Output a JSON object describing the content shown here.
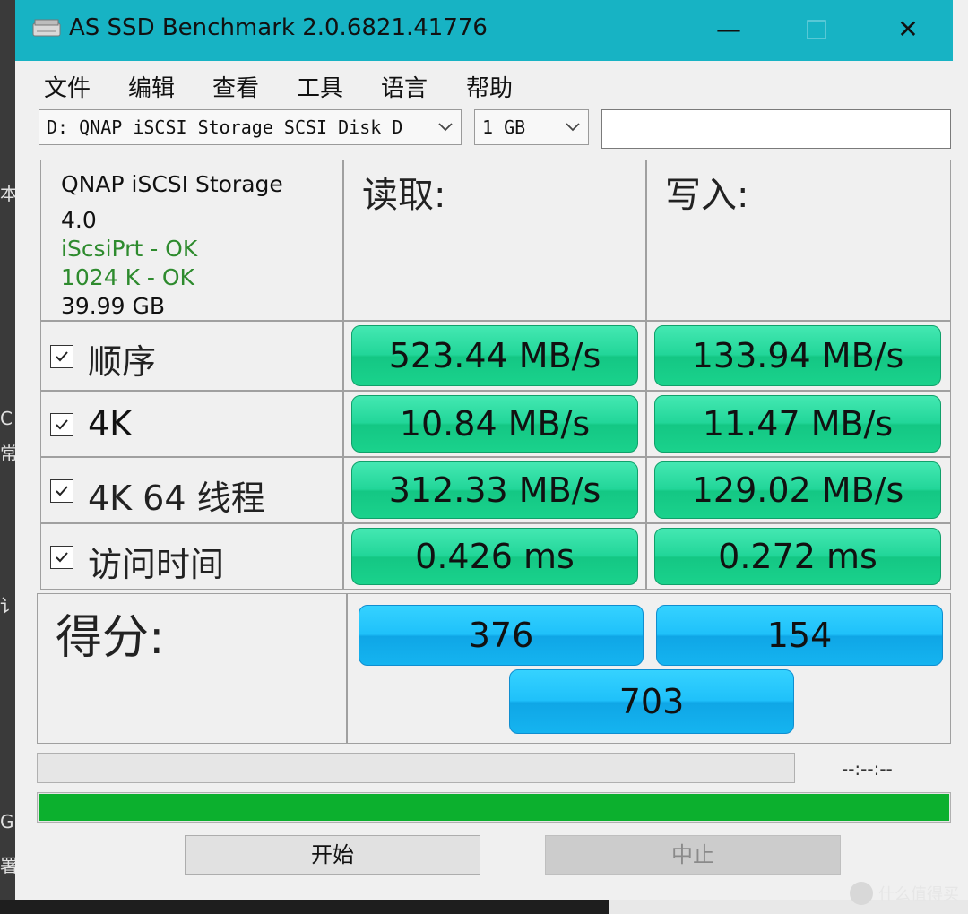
{
  "window": {
    "title": "AS SSD Benchmark 2.0.6821.41776",
    "minimize_glyph": "—",
    "close_glyph": "✕"
  },
  "menu": [
    "文件",
    "编辑",
    "查看",
    "工具",
    "语言",
    "帮助"
  ],
  "toolbar": {
    "drive_select": "D: QNAP iSCSI Storage SCSI Disk D",
    "size_select": "1 GB",
    "text_field_value": ""
  },
  "drive_info": {
    "name": "QNAP iSCSI Storage",
    "version": "4.0",
    "driver_status": "iScsiPrt - OK",
    "alignment_status": "1024 K - OK",
    "capacity": "39.99 GB"
  },
  "headers": {
    "read": "读取:",
    "write": "写入:"
  },
  "rows": [
    {
      "label": "顺序",
      "checked": true,
      "read": "523.44 MB/s",
      "write": "133.94 MB/s"
    },
    {
      "label": "4K",
      "checked": true,
      "read": "10.84 MB/s",
      "write": "11.47 MB/s"
    },
    {
      "label": "4K 64 线程",
      "checked": true,
      "read": "312.33 MB/s",
      "write": "129.02 MB/s"
    },
    {
      "label": "访问时间",
      "checked": true,
      "read": "0.426 ms",
      "write": "0.272 ms"
    }
  ],
  "score": {
    "label": "得分:",
    "read": "376",
    "write": "154",
    "total": "703"
  },
  "progress": {
    "time_text": "--:--:--",
    "bar_fraction": 1.0
  },
  "buttons": {
    "start": "开始",
    "stop": "中止"
  },
  "watermark": "什么值得买",
  "colors": {
    "titlebar": "#17b3c4",
    "result_green": "#22d699",
    "score_blue": "#1fc1fa",
    "progress_green": "#0cb02e",
    "ok_text": "#2e8b2e"
  },
  "icons": [
    "drive-icon",
    "minimize-icon",
    "maximize-icon",
    "close-icon",
    "chevron-down-icon",
    "checkbox-icon"
  ]
}
